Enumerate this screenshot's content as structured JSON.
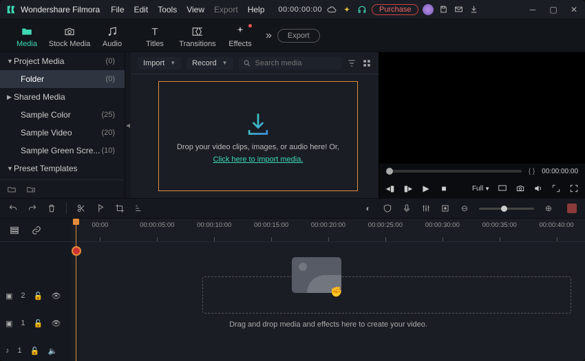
{
  "title": "Wondershare Filmora",
  "menu": [
    "File",
    "Edit",
    "Tools",
    "View",
    "Export",
    "Help"
  ],
  "titlebar_timecode": "00:00:00:00",
  "purchase_label": "Purchase",
  "tabs": [
    {
      "label": "Media",
      "active": true
    },
    {
      "label": "Stock Media"
    },
    {
      "label": "Audio"
    },
    {
      "label": "Titles"
    },
    {
      "label": "Transitions"
    },
    {
      "label": "Effects",
      "notify": true
    }
  ],
  "export_label": "Export",
  "sidebar": {
    "items": [
      {
        "label": "Project Media",
        "count": "(0)",
        "parent": true,
        "open": true
      },
      {
        "label": "Folder",
        "count": "(0)",
        "sub": true,
        "sel": true
      },
      {
        "label": "Shared Media",
        "parent": true,
        "open": false
      },
      {
        "label": "Sample Color",
        "count": "(25)",
        "sub": true
      },
      {
        "label": "Sample Video",
        "count": "(20)",
        "sub": true
      },
      {
        "label": "Sample Green Scre...",
        "count": "(10)",
        "sub": true
      },
      {
        "label": "Preset Templates",
        "parent": true,
        "open": true
      }
    ]
  },
  "media_toolbar": {
    "import_label": "Import",
    "record_label": "Record",
    "search_placeholder": "Search media"
  },
  "dropzone": {
    "line1": "Drop your video clips, images, or audio here! Or,",
    "link": "Click here to import media."
  },
  "preview": {
    "dur_braces": "{        }",
    "timecode": "00:00:00:00",
    "full_label": "Full"
  },
  "ruler": [
    "00:00",
    "00:00:05:00",
    "00:00:10:00",
    "00:00:15:00",
    "00:00:20:00",
    "00:00:25:00",
    "00:00:30:00",
    "00:00:35:00",
    "00:00:40:00"
  ],
  "tracks": [
    {
      "label": "2",
      "type": "video"
    },
    {
      "label": "1",
      "type": "video"
    },
    {
      "label": "1",
      "type": "audio"
    }
  ],
  "timeline_hint": "Drag and drop media and effects here to create your video."
}
